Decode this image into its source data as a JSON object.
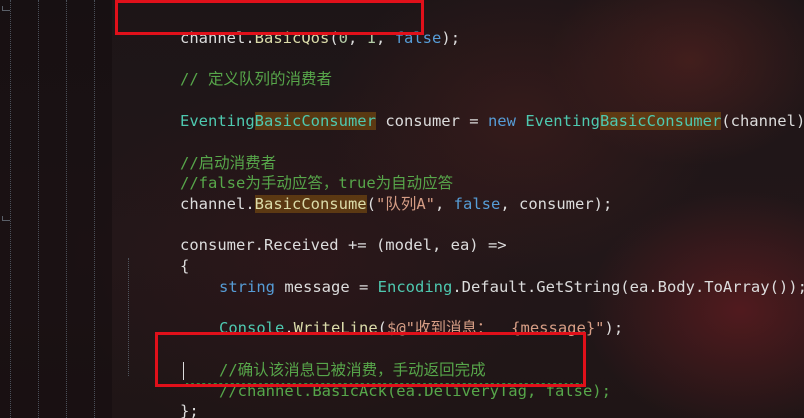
{
  "code": {
    "line1": {
      "obj": "channel.",
      "method": "BasicQos",
      "open": "(",
      "n0": "0",
      "comma1": ", ",
      "n1": "1",
      "comma2": ", ",
      "kw": "false",
      "close": ");"
    },
    "line2": {
      "comment": "// 定义队列的消费者"
    },
    "line3": {
      "type1": "Eventing",
      "type2": "BasicConsumer",
      "var": " consumer = ",
      "kw": "new",
      "sp": " ",
      "type3": "Eventing",
      "type4": "BasicConsumer",
      "args": "(channel);"
    },
    "line4": {
      "comment": "//启动消费者"
    },
    "line5": {
      "comment": "//false为手动应答，true为自动应答"
    },
    "line6": {
      "obj": "channel.",
      "method": "BasicConsume",
      "open": "(",
      "str": "\"队列A\"",
      "comma": ", ",
      "kw": "false",
      "rest": ", consumer);"
    },
    "line7": {
      "text": "consumer.Received += (model, ea) =>"
    },
    "line8": {
      "text": "{"
    },
    "line9": {
      "kw": "string",
      "mid": " message = ",
      "type": "Encoding",
      "rest": ".Default.GetString(ea.Body.ToArray());"
    },
    "line10": {
      "type": "Console",
      "dot": ".",
      "method": "WriteLine",
      "open": "(",
      "str": "$@\"收到消息：  {message}\"",
      "close": ");"
    },
    "line11": {
      "comment": "//确认该消息已被消费，手动返回完成"
    },
    "line12": {
      "comment": "//channel.BasicAck(ea.DeliveryTag, false);"
    },
    "line13": {
      "text": "};"
    }
  },
  "colors": {
    "keyword": "#569cd6",
    "type": "#4ec9b0",
    "method": "#dcdcaa",
    "number": "#b5cea8",
    "string": "#d69d85",
    "comment": "#57a64a",
    "highlight_box": "#e0101a"
  }
}
